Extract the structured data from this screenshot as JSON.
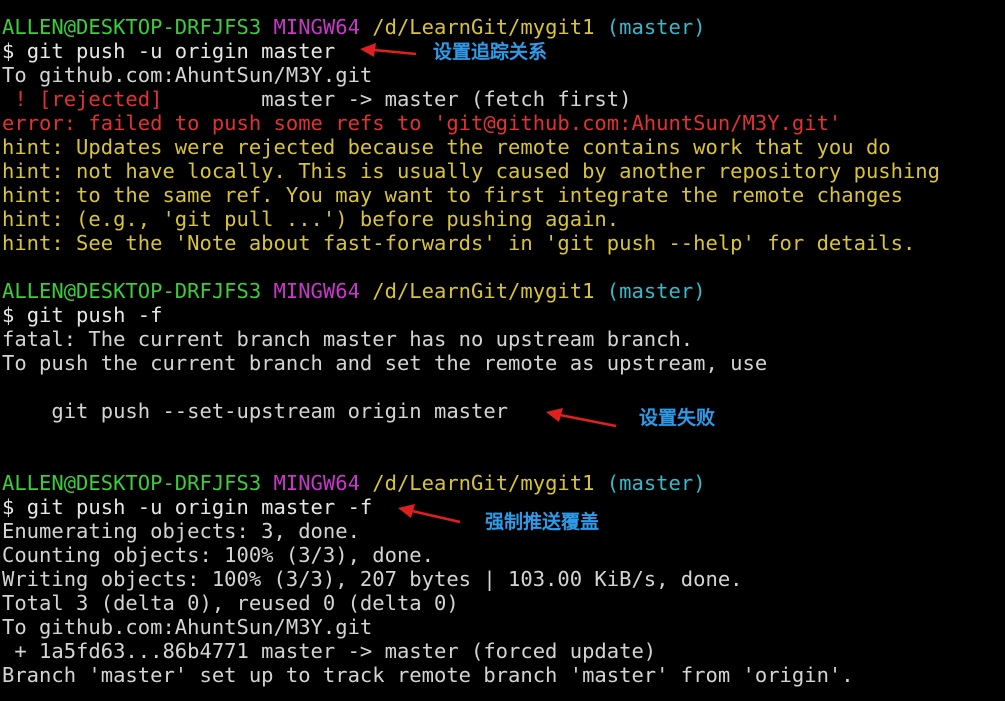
{
  "terminal": {
    "prompt_user": "ALLEN@DESKTOP-DRFJFS3",
    "prompt_system": "MINGW64",
    "prompt_path": "/d/LearnGit/mygit1",
    "prompt_branch": "(master)",
    "dollar": "$",
    "lines": [
      {
        "type": "prompt"
      },
      {
        "type": "cmd",
        "text": "git push -u origin master"
      },
      {
        "type": "out",
        "text": "To github.com:AhuntSun/M3Y.git"
      },
      {
        "type": "rejected",
        "mark": " ! [rejected]",
        "text": "        master -> master (fetch first)"
      },
      {
        "type": "err",
        "text": "error: failed to push some refs to 'git@github.com:AhuntSun/M3Y.git'"
      },
      {
        "type": "hint",
        "text": "hint: Updates were rejected because the remote contains work that you do"
      },
      {
        "type": "hint",
        "text": "hint: not have locally. This is usually caused by another repository pushing"
      },
      {
        "type": "hint",
        "text": "hint: to the same ref. You may want to first integrate the remote changes"
      },
      {
        "type": "hint",
        "text": "hint: (e.g., 'git pull ...') before pushing again."
      },
      {
        "type": "hint",
        "text": "hint: See the 'Note about fast-forwards' in 'git push --help' for details."
      },
      {
        "type": "blank"
      },
      {
        "type": "prompt"
      },
      {
        "type": "cmd",
        "text": "git push -f"
      },
      {
        "type": "out",
        "text": "fatal: The current branch master has no upstream branch."
      },
      {
        "type": "out",
        "text": "To push the current branch and set the remote as upstream, use"
      },
      {
        "type": "blank"
      },
      {
        "type": "out",
        "text": "    git push --set-upstream origin master"
      },
      {
        "type": "blank"
      },
      {
        "type": "blank"
      },
      {
        "type": "prompt"
      },
      {
        "type": "cmd",
        "text": "git push -u origin master -f"
      },
      {
        "type": "out",
        "text": "Enumerating objects: 3, done."
      },
      {
        "type": "out",
        "text": "Counting objects: 100% (3/3), done."
      },
      {
        "type": "out",
        "text": "Writing objects: 100% (3/3), 207 bytes | 103.00 KiB/s, done."
      },
      {
        "type": "out",
        "text": "Total 3 (delta 0), reused 0 (delta 0)"
      },
      {
        "type": "out",
        "text": "To github.com:AhuntSun/M3Y.git"
      },
      {
        "type": "out",
        "text": " + 1a5fd63...86b4771 master -> master (forced update)"
      },
      {
        "type": "out",
        "text": "Branch 'master' set up to track remote branch 'master' from 'origin'."
      }
    ]
  },
  "annotations": [
    {
      "text": "设置追踪关系"
    },
    {
      "text": "设置失败"
    },
    {
      "text": "强制推送覆盖"
    }
  ],
  "colors": {
    "background": "#000000",
    "prompt_user": "#3ccc3c",
    "prompt_system": "#c838c8",
    "prompt_path": "#d8c43c",
    "prompt_branch": "#38b8c8",
    "error": "#e03232",
    "hint": "#d8c43c",
    "annotation": "#2f9be8",
    "arrow": "#e02020"
  }
}
